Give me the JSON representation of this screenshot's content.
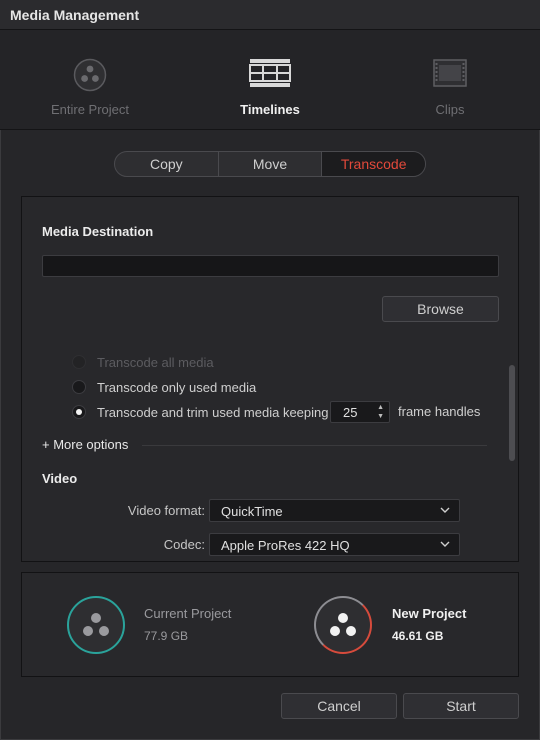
{
  "window": {
    "title": "Media Management"
  },
  "modes": [
    {
      "label": "Entire Project",
      "icon": "davinci-logo-icon"
    },
    {
      "label": "Timelines",
      "icon": "timeline-icon"
    },
    {
      "label": "Clips",
      "icon": "clips-icon"
    }
  ],
  "active_mode": "Timelines",
  "actions": [
    {
      "label": "Copy"
    },
    {
      "label": "Move"
    },
    {
      "label": "Transcode"
    }
  ],
  "active_action": "Transcode",
  "media_destination": {
    "heading": "Media Destination",
    "value": "",
    "browse_label": "Browse"
  },
  "transcode_options": [
    {
      "label": "Transcode all media",
      "state": "disabled"
    },
    {
      "label": "Transcode only used media",
      "state": "unchecked"
    },
    {
      "label": "Transcode and trim used media keeping",
      "state": "checked"
    }
  ],
  "frame_handles": {
    "value": "25",
    "suffix": "frame handles"
  },
  "more_options_label": "+ More options",
  "video": {
    "heading": "Video",
    "format_label": "Video format:",
    "format_value": "QuickTime",
    "codec_label": "Codec:",
    "codec_value": "Apple ProRes 422 HQ"
  },
  "summary": {
    "current": {
      "name": "Current Project",
      "size": "77.9 GB"
    },
    "new": {
      "name": "New Project",
      "size": "46.61 GB"
    }
  },
  "buttons": {
    "cancel": "Cancel",
    "start": "Start"
  },
  "colors": {
    "accent": "#e2493a",
    "teal": "#2aa39b"
  }
}
